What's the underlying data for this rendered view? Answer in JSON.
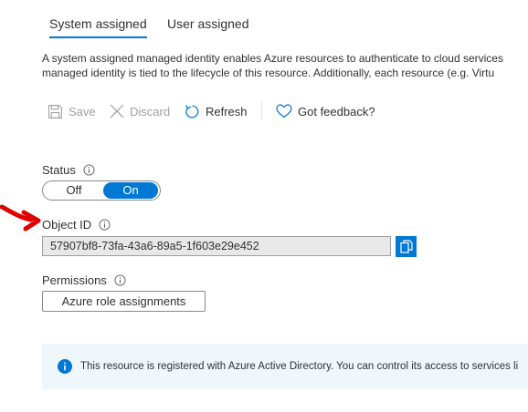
{
  "tabs": [
    {
      "label": "System assigned",
      "active": true
    },
    {
      "label": "User assigned",
      "active": false
    }
  ],
  "description": {
    "line1": "A system assigned managed identity enables Azure resources to authenticate to cloud services",
    "line2": "managed identity is tied to the lifecycle of this resource. Additionally, each resource (e.g. Virtu"
  },
  "toolbar": {
    "save_label": "Save",
    "discard_label": "Discard",
    "refresh_label": "Refresh",
    "feedback_label": "Got feedback?"
  },
  "status": {
    "label": "Status",
    "off_label": "Off",
    "on_label": "On",
    "value": "On"
  },
  "object_id": {
    "label": "Object ID",
    "value": "57907bf8-73fa-43a6-89a5-1f603e29e452"
  },
  "permissions": {
    "label": "Permissions",
    "button_label": "Azure role assignments"
  },
  "banner": {
    "text": "This resource is registered with Azure Active Directory. You can control its access to services li"
  },
  "colors": {
    "accent": "#0078d4",
    "arrow": "#e00000",
    "banner_bg": "#eff6fc"
  }
}
